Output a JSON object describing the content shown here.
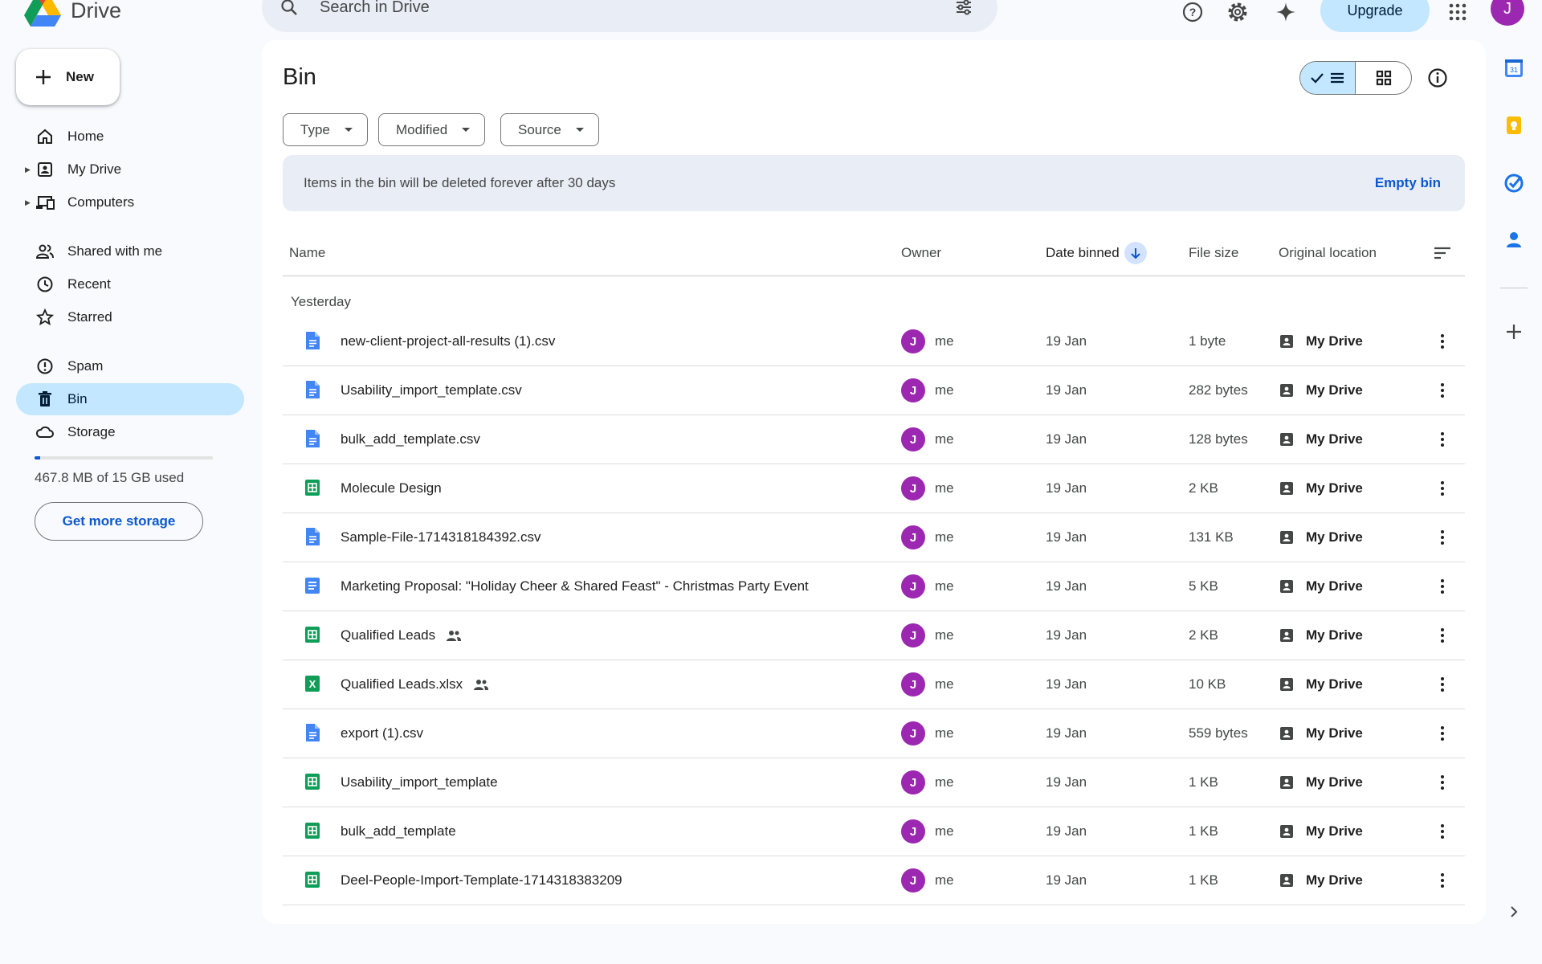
{
  "app": {
    "name": "Drive"
  },
  "search": {
    "placeholder": "Search in Drive"
  },
  "header": {
    "upgrade_label": "Upgrade",
    "avatar_letter": "J"
  },
  "sidebar": {
    "new_label": "New",
    "items": [
      {
        "label": "Home",
        "icon": "home-icon"
      },
      {
        "label": "My Drive",
        "icon": "my-drive-icon"
      },
      {
        "label": "Computers",
        "icon": "computers-icon"
      },
      {
        "label": "Shared with me",
        "icon": "shared-icon"
      },
      {
        "label": "Recent",
        "icon": "clock-icon"
      },
      {
        "label": "Starred",
        "icon": "star-icon"
      },
      {
        "label": "Spam",
        "icon": "spam-icon"
      },
      {
        "label": "Bin",
        "icon": "bin-icon",
        "active": true
      },
      {
        "label": "Storage",
        "icon": "cloud-icon"
      }
    ],
    "storage_used_text": "467.8 MB of 15 GB used",
    "storage_fraction": 0.03,
    "get_more_storage_label": "Get more storage"
  },
  "main": {
    "title": "Bin",
    "filters": [
      "Type",
      "Modified",
      "Source"
    ],
    "banner": {
      "text": "Items in the bin will be deleted forever after 30 days",
      "action": "Empty bin"
    },
    "columns": {
      "name": "Name",
      "owner": "Owner",
      "date": "Date binned",
      "size": "File size",
      "location": "Original location"
    },
    "group_label": "Yesterday",
    "files": [
      {
        "name": "new-client-project-all-results (1).csv",
        "type": "doc",
        "shared": false,
        "owner": "me",
        "date": "19 Jan",
        "size": "1 byte",
        "location": "My Drive"
      },
      {
        "name": "Usability_import_template.csv",
        "type": "doc",
        "shared": false,
        "owner": "me",
        "date": "19 Jan",
        "size": "282 bytes",
        "location": "My Drive"
      },
      {
        "name": "bulk_add_template.csv",
        "type": "doc",
        "shared": false,
        "owner": "me",
        "date": "19 Jan",
        "size": "128 bytes",
        "location": "My Drive"
      },
      {
        "name": "Molecule Design",
        "type": "sheet",
        "shared": false,
        "owner": "me",
        "date": "19 Jan",
        "size": "2 KB",
        "location": "My Drive"
      },
      {
        "name": "Sample-File-1714318184392.csv",
        "type": "doc",
        "shared": false,
        "owner": "me",
        "date": "19 Jan",
        "size": "131 KB",
        "location": "My Drive"
      },
      {
        "name": "Marketing Proposal: \"Holiday Cheer & Shared Feast\" - Christmas Party Event",
        "type": "gdoc",
        "shared": false,
        "owner": "me",
        "date": "19 Jan",
        "size": "5 KB",
        "location": "My Drive"
      },
      {
        "name": "Qualified Leads",
        "type": "sheet",
        "shared": true,
        "owner": "me",
        "date": "19 Jan",
        "size": "2 KB",
        "location": "My Drive"
      },
      {
        "name": "Qualified Leads.xlsx",
        "type": "excel",
        "shared": true,
        "owner": "me",
        "date": "19 Jan",
        "size": "10 KB",
        "location": "My Drive"
      },
      {
        "name": "export (1).csv",
        "type": "doc",
        "shared": false,
        "owner": "me",
        "date": "19 Jan",
        "size": "559 bytes",
        "location": "My Drive"
      },
      {
        "name": "Usability_import_template",
        "type": "sheet",
        "shared": false,
        "owner": "me",
        "date": "19 Jan",
        "size": "1 KB",
        "location": "My Drive"
      },
      {
        "name": "bulk_add_template",
        "type": "sheet",
        "shared": false,
        "owner": "me",
        "date": "19 Jan",
        "size": "1 KB",
        "location": "My Drive"
      },
      {
        "name": "Deel-People-Import-Template-1714318383209",
        "type": "sheet",
        "shared": false,
        "owner": "me",
        "date": "19 Jan",
        "size": "1 KB",
        "location": "My Drive"
      }
    ]
  },
  "owner_avatar_letter": "J",
  "colors": {
    "accent": "#0b57d0",
    "active_bg": "#c2e7ff",
    "avatar": "#9c27b0",
    "doc_blue": "#4285f4",
    "sheet_green": "#0f9d58"
  }
}
